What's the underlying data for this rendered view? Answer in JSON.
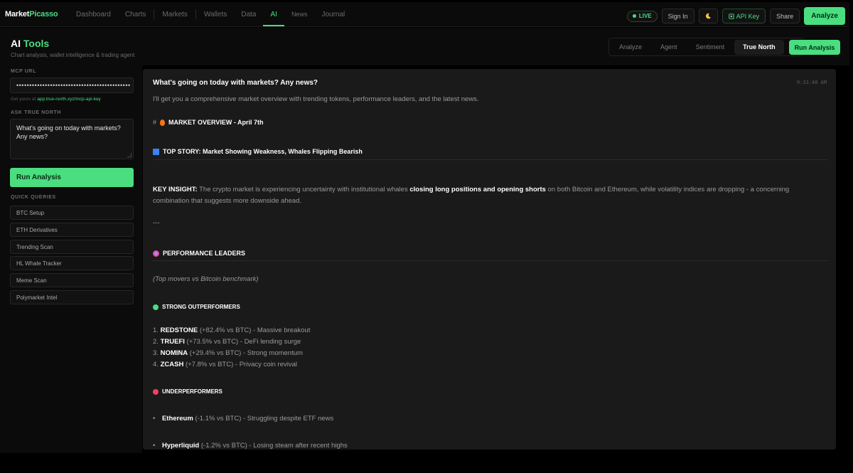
{
  "app": {
    "logo_part1": "Market",
    "logo_part2": "Picasso"
  },
  "nav": {
    "items": [
      "Dashboard",
      "Charts",
      "Markets",
      "Wallets",
      "Data",
      "AI",
      "News",
      "Journal"
    ],
    "active": "AI"
  },
  "topbar": {
    "live": "LIVE",
    "sign_in": "Sign In",
    "theme_icon": "moon-icon",
    "api_key": "API Key",
    "share": "Share",
    "analyze": "Analyze"
  },
  "header": {
    "title_part1": "AI",
    "title_part2": "Tools",
    "subtitle": "Chart analysis, wallet intelligence & trading agent",
    "tabs": [
      "Analyze",
      "Agent",
      "Sentiment",
      "True North"
    ],
    "active_tab": "True North",
    "run_button": "Run Analysis"
  },
  "sidebar": {
    "mcp_label": "MCP URL",
    "mcp_value": "••••••••••••••••••••••••••••••••••••••••••••",
    "get_yours_prefix": "Get yours at",
    "get_yours_link": "app.true-north.xyz/mcp-api-key",
    "ask_label": "ASK TRUE NORTH",
    "ask_value": "What's going on today with markets? Any news?",
    "run_button": "Run Analysis",
    "quick_label": "QUICK QUERIES",
    "quick_queries": [
      "BTC Setup",
      "ETH Derivatives",
      "Trending Scan",
      "HL Whale Tracker",
      "Meme Scan",
      "Polymarket Intel"
    ]
  },
  "chat": {
    "question": "What's going on today with markets? Any news?",
    "timestamp": "9:33:48 AM",
    "intro": "I'll get you a comprehensive market overview with trending tokens, performance leaders, and the latest news.",
    "overview_hash": "#",
    "overview_title": "MARKET OVERVIEW - April 7th",
    "top_story": "TOP STORY: Market Showing Weakness, Whales Flipping Bearish",
    "key_insight_label": "KEY INSIGHT:",
    "key_insight_pre": "The crypto market is experiencing uncertainty with institutional whales",
    "key_insight_bold": "closing long positions and opening shorts",
    "key_insight_post": "on both Bitcoin and Ethereum, while volatility indices are dropping - a concerning",
    "key_insight_line2": "combination that suggests more downside ahead.",
    "separator": "---",
    "performance_title": "PERFORMANCE LEADERS",
    "performance_sub": "(Top movers vs Bitcoin benchmark)",
    "outperformers_title": "STRONG OUTPERFORMERS",
    "outperformers": [
      {
        "num": "1.",
        "name": "REDSTONE",
        "detail": "(+82.4% vs BTC) - Massive breakout"
      },
      {
        "num": "2.",
        "name": "TRUEFI",
        "detail": "(+73.5% vs BTC) - DeFi lending surge"
      },
      {
        "num": "3.",
        "name": "NOMINA",
        "detail": "(+29.4% vs BTC) - Strong momentum"
      },
      {
        "num": "4.",
        "name": "ZCASH",
        "detail": "(+7.8% vs BTC) - Privacy coin revival"
      }
    ],
    "underperformers_title": "UNDERPERFORMERS",
    "underperformers": [
      {
        "name": "Ethereum",
        "detail": "(-1.1% vs BTC) - Struggling despite ETF news"
      },
      {
        "name": "Hyperliquid",
        "detail": "(-1.2% vs BTC) - Losing steam after recent highs"
      }
    ]
  },
  "colors": {
    "accent": "#4ade80",
    "background": "#000000",
    "panel": "#1a1a1a"
  }
}
